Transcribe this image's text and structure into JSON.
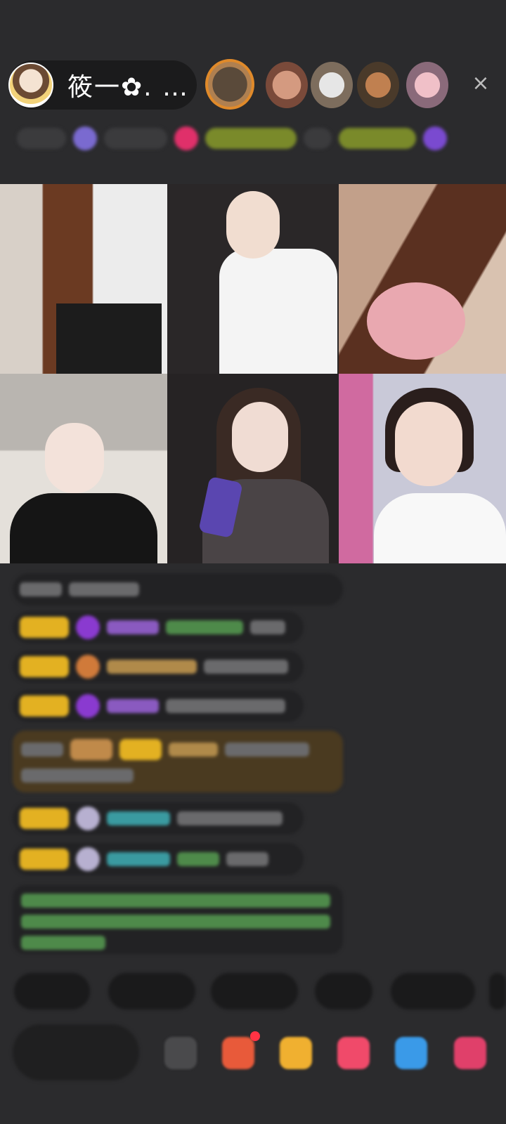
{
  "header": {
    "host_name": "筱一✿. …",
    "close_icon": "×"
  },
  "colors": {
    "background": "#2b2b2d",
    "pill": "#1b1b1c",
    "accent_gold": "#e3b122",
    "accent_green": "#7a8a2a"
  },
  "icons": [
    "close-icon",
    "more-icon",
    "gift-icon",
    "shop-icon",
    "game-icon",
    "share-icon"
  ]
}
